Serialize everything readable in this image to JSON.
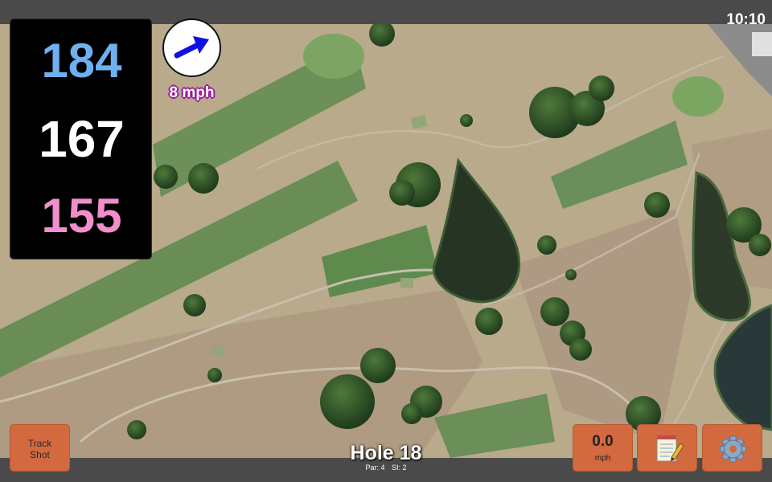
{
  "status_bar": {
    "time": "10:10"
  },
  "yardages": {
    "back": "184",
    "middle": "167",
    "front": "155"
  },
  "wind": {
    "speed_label": "8 mph",
    "arrow_icon": "wind-direction-arrow-icon",
    "arrow_color": "#1010e0"
  },
  "track_shot": {
    "line1": "Track",
    "line2": "Shot"
  },
  "hole": {
    "title": "Hole 18",
    "par": "Par: 4",
    "si": "SI: 2"
  },
  "speed_button": {
    "value": "0.0",
    "unit": "mph"
  },
  "notes_button": {
    "icon": "notepad-icon"
  },
  "settings_button": {
    "icon": "gear-icon"
  },
  "colors": {
    "back_yardage": "#6fb0f0",
    "middle_yardage": "#ffffff",
    "front_yardage": "#f08fcc",
    "button_orange": "#d2693f",
    "wind_label_outline": "#9b1a9b"
  }
}
